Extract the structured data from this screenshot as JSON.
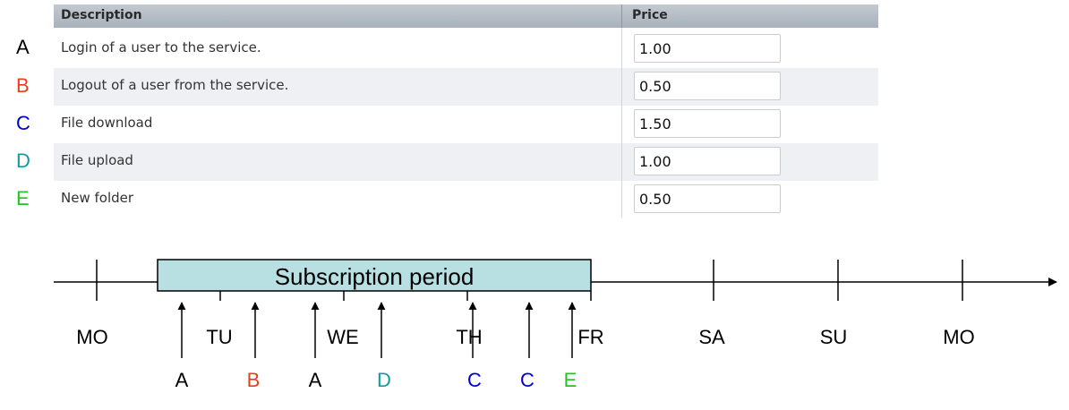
{
  "table": {
    "headers": {
      "description": "Description",
      "price": "Price"
    },
    "rows": [
      {
        "letter": "A",
        "letter_color": "#000000",
        "description": "Login of a user to the service.",
        "price": "1.00"
      },
      {
        "letter": "B",
        "letter_color": "#e8401c",
        "description": "Logout of a user from the service.",
        "price": "0.50"
      },
      {
        "letter": "C",
        "letter_color": "#0000c8",
        "description": "File download",
        "price": "1.50"
      },
      {
        "letter": "D",
        "letter_color": "#119b9b",
        "description": "File upload",
        "price": "1.00"
      },
      {
        "letter": "E",
        "letter_color": "#1fc61f",
        "description": "New folder",
        "price": "0.50"
      }
    ]
  },
  "timeline": {
    "period_label": "Subscription period",
    "period_fill": "#b8dfe2",
    "days": [
      "MO",
      "TU",
      "WE",
      "TH",
      "FR",
      "SA",
      "SU",
      "MO"
    ],
    "events": [
      {
        "letter": "A",
        "color": "#000000"
      },
      {
        "letter": "B",
        "color": "#e8401c"
      },
      {
        "letter": "A",
        "color": "#000000"
      },
      {
        "letter": "D",
        "color": "#119b9b"
      },
      {
        "letter": "C",
        "color": "#0000c8"
      },
      {
        "letter": "C",
        "color": "#0000c8"
      },
      {
        "letter": "E",
        "color": "#1fc61f"
      }
    ]
  }
}
